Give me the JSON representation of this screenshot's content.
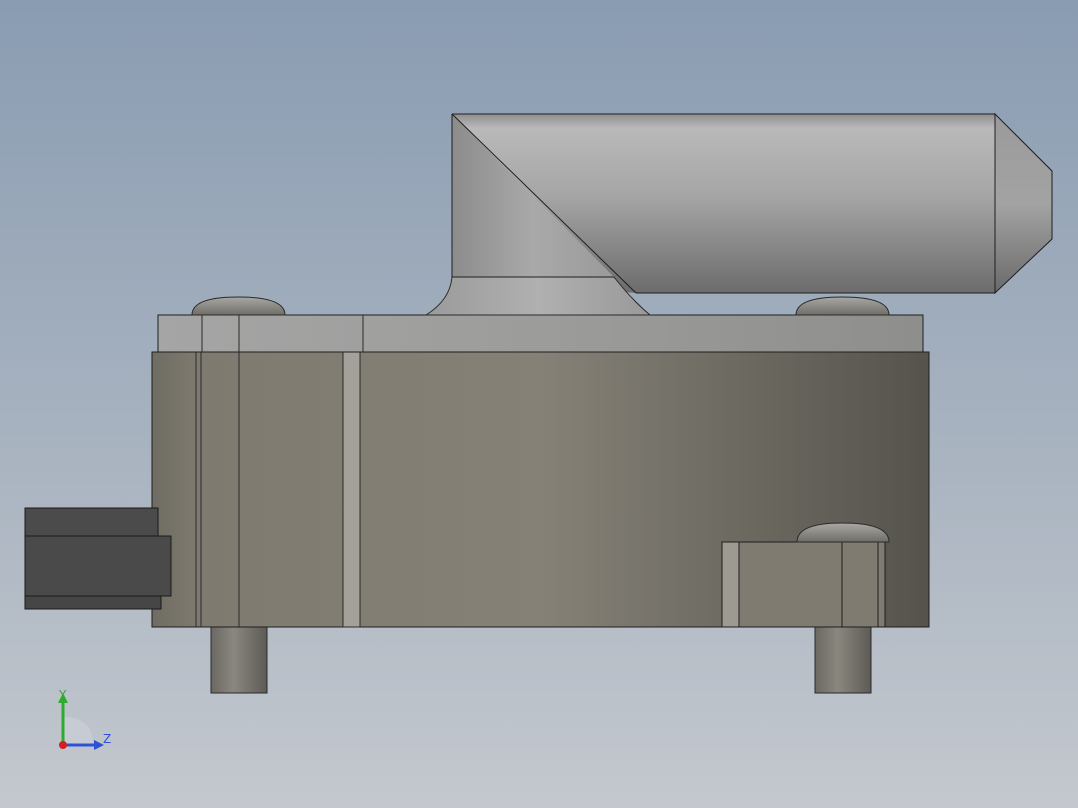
{
  "viewport": {
    "background_top": "#8a9cb2",
    "background_bottom": "#c4c8ce"
  },
  "model": {
    "body_color": "#7f7b70",
    "cylinder_color": "#a9a9a9",
    "connector_color": "#4a4a4a",
    "parts": [
      "main-housing",
      "top-plate",
      "elbow-nozzle",
      "nozzle-tip",
      "mount-screw-left",
      "mount-screw-right",
      "side-connector",
      "bottom-post-left",
      "bottom-post-right",
      "side-bracket",
      "bracket-screw"
    ]
  },
  "triad": {
    "y_label": "Y",
    "z_label": "Z",
    "x_color": "#d02020",
    "y_color": "#2eaa2e",
    "z_color": "#3050d8"
  }
}
